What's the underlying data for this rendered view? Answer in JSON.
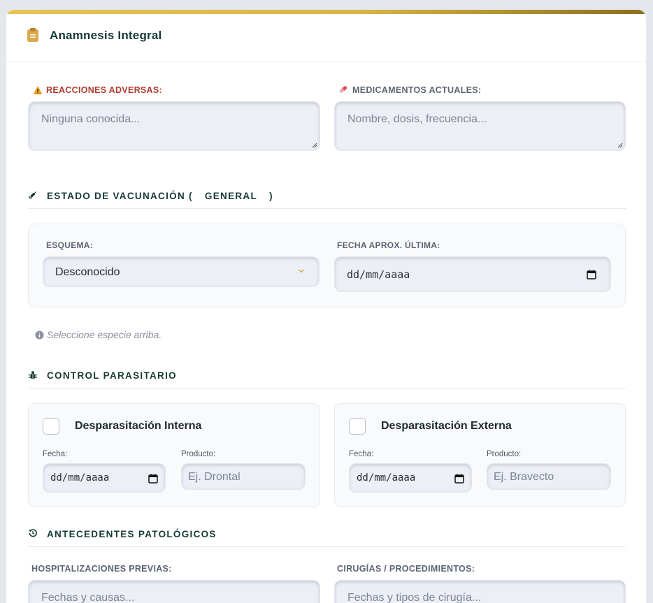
{
  "header": {
    "title": "Anamnesis Integral",
    "icon": "clipboard-icon"
  },
  "adverse": {
    "label": "REACCIONES ADVERSAS:",
    "placeholder": "Ninguna conocida...",
    "icon": "warning-icon",
    "color": "#b03a2e"
  },
  "medications": {
    "label": "MEDICAMENTOS ACTUALES:",
    "placeholder": "Nombre, dosis, frecuencia...",
    "icon": "pill-icon"
  },
  "vaccination": {
    "title_prefix": "ESTADO DE VACUNACIÓN (",
    "species": "GENERAL",
    "title_suffix": ")",
    "icon": "syringe-icon",
    "scheme_label": "ESQUEMA:",
    "scheme_value": "Desconocido",
    "date_label": "FECHA APROX. ÚLTIMA:",
    "date_placeholder": "dd/mm/aaaa",
    "hint": "Seleccione especie arriba."
  },
  "parasites": {
    "title": "CONTROL PARASITARIO",
    "icon": "bug-icon",
    "internal": {
      "label": "Desparasitación Interna",
      "date_label": "Fecha:",
      "date_placeholder": "dd/mm/aaaa",
      "product_label": "Producto:",
      "product_placeholder": "Ej. Drontal"
    },
    "external": {
      "label": "Desparasitación Externa",
      "date_label": "Fecha:",
      "date_placeholder": "dd/mm/aaaa",
      "product_label": "Producto:",
      "product_placeholder": "Ej. Bravecto"
    }
  },
  "history": {
    "title": "ANTECEDENTES PATOLÓGICOS",
    "icon": "history-icon",
    "hospital_label": "HOSPITALIZACIONES PREVIAS:",
    "hospital_placeholder": "Fechas y causas...",
    "surgery_label": "CIRUGÍAS / PROCEDIMIENTOS:",
    "surgery_placeholder": "Fechas y tipos de cirugía..."
  },
  "colors": {
    "accent_gold": "#d8b545",
    "title_green": "#173a35",
    "warning_red": "#b03a2e"
  }
}
